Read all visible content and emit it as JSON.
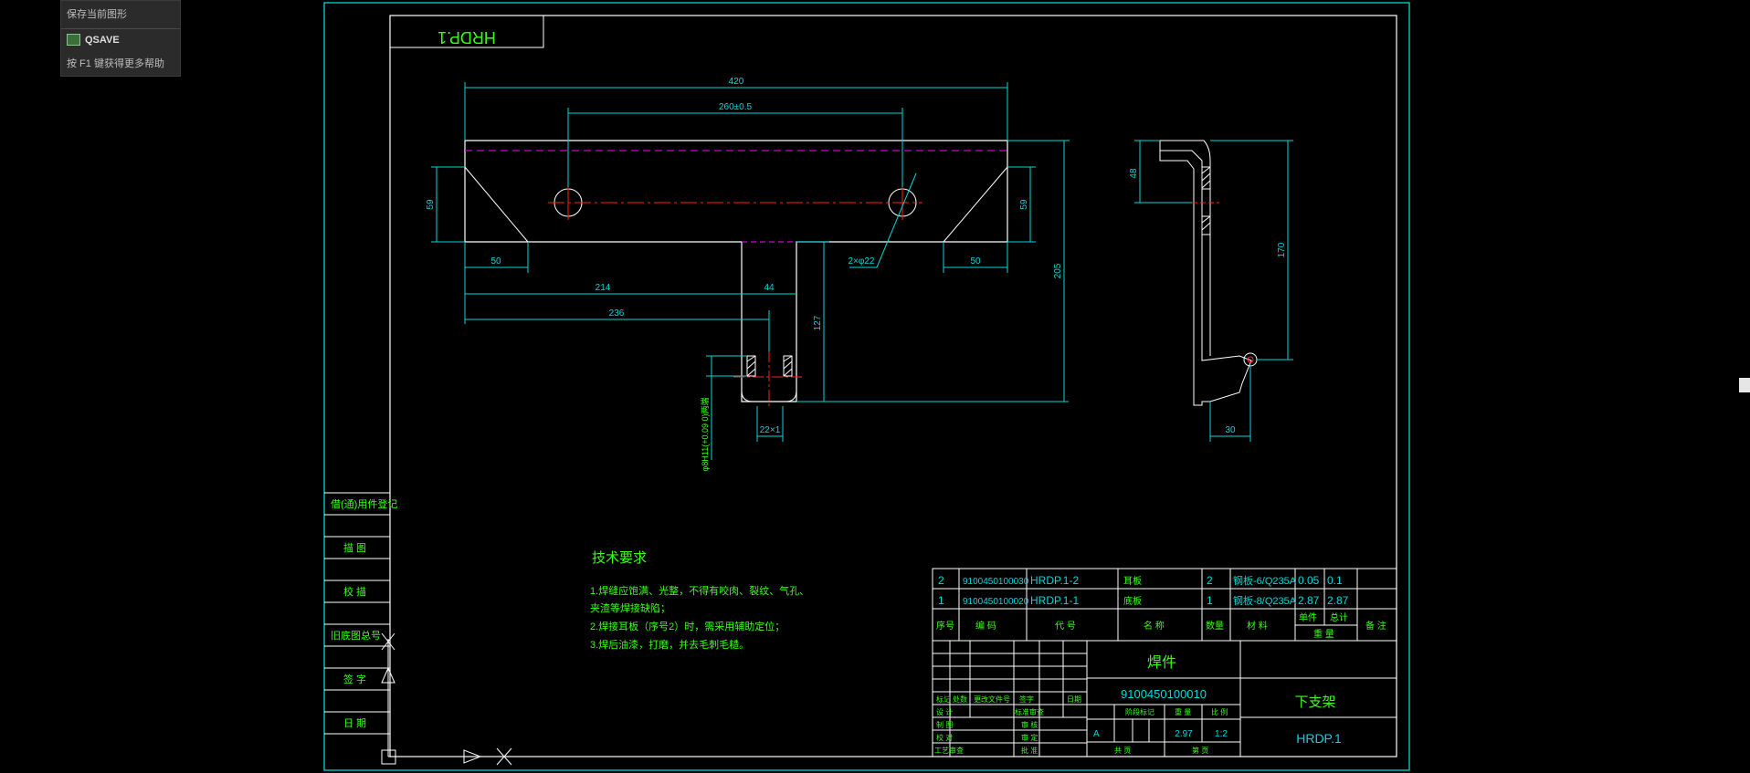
{
  "tooltip": {
    "title": "保存当前图形",
    "command": "QSAVE",
    "hint": "按 F1 键获得更多帮助"
  },
  "drawing": {
    "number_stamp": "HRDP.1",
    "colors": {
      "frame": "#00e5e5",
      "geometry": "#ffffff",
      "dimension": "#00d8d8",
      "text": "#39ff14",
      "center": "#ff2020",
      "hidden": "#ff00ff"
    },
    "dimensions": {
      "d420": "420",
      "d260": "260±0.5",
      "d59a": "59",
      "d59b": "59",
      "d50a": "50",
      "d50b": "50",
      "d214": "214",
      "d44": "44",
      "d236": "236",
      "d2x22": "2×φ22",
      "d127": "127",
      "d205": "205",
      "d22x1": "22×1",
      "dhole": "φ8H11(+0.09 0)两端",
      "d48": "48",
      "d170": "170",
      "d30": "30"
    },
    "side_labels": [
      "借(通)用件登记",
      "描 图",
      "校 描",
      "旧底图总号",
      "签 字",
      "日 期"
    ],
    "tech_requirements": {
      "title": "技术要求",
      "lines": [
        "1.焊缝应饱满、光整，不得有咬肉、裂纹、气孔、",
        "  夹渣等焊接缺陷；",
        "2.焊接耳板（序号2）时，需采用辅助定位；",
        "3.焊后油漆，打磨，并去毛刺毛糙。"
      ]
    },
    "bom": {
      "rows": [
        {
          "seq": "2",
          "code": "9100450100030",
          "drawing_no": "HRDP.1-2",
          "name": "耳板",
          "qty": "2",
          "material": "钢板-6/Q235A",
          "unit_wt": "0.05",
          "total_wt": "0.1"
        },
        {
          "seq": "1",
          "code": "9100450100020",
          "drawing_no": "HRDP.1-1",
          "name": "底板",
          "qty": "1",
          "material": "钢板-8/Q235A",
          "unit_wt": "2.87",
          "total_wt": "2.87"
        }
      ],
      "headers": {
        "seq": "序号",
        "code": "编 码",
        "drawing_no": "代 号",
        "name": "名 称",
        "qty": "数量",
        "material": "材 料",
        "unit": "单件",
        "total": "总计",
        "weight": "重 量",
        "remark": "备 注"
      }
    },
    "title_block": {
      "part_type": "焊件",
      "part_code": "9100450100010",
      "part_name": "下支架",
      "drawing_no": "HRDP.1",
      "stage": "A",
      "weight": "2.97",
      "scale": "1:2",
      "labels": {
        "mark": "标记",
        "count": "处数",
        "change_doc": "更改文件号",
        "sign": "签字",
        "date": "日期",
        "design": "设 计",
        "draw": "制 图",
        "proofread": "校 对",
        "review": "审 核",
        "process": "工艺审查",
        "std": "标准审查",
        "approve": "审 定",
        "approve2": "批 准",
        "stage_mark": "阶段标记",
        "weight_lbl": "重 量",
        "scale_lbl": "比 例",
        "sheets": "共 页",
        "sheet": "第 页"
      }
    }
  }
}
